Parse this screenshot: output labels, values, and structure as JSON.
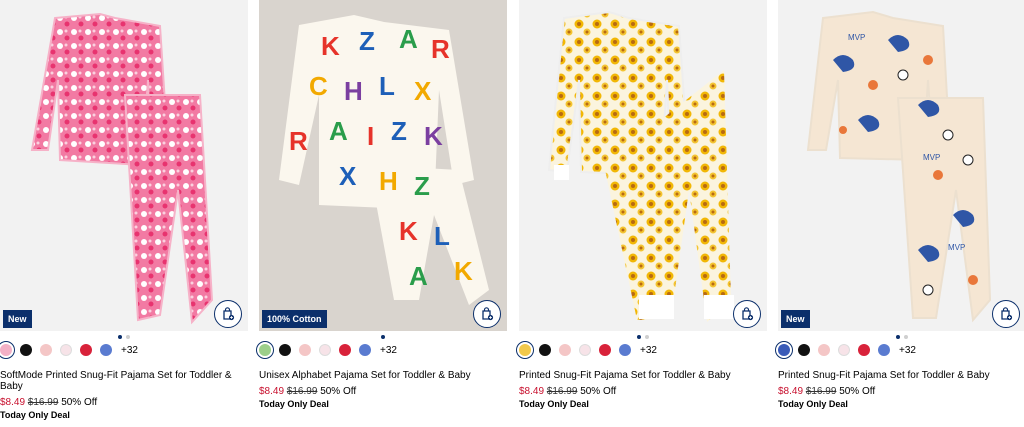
{
  "products": [
    {
      "badge": "New",
      "name": "SoftMode Printed Snug-Fit Pajama Set for Toddler & Baby",
      "sale_price": "$8.49",
      "original_price": "$16.99",
      "discount": "50% Off",
      "deal": "Today Only Deal",
      "more_colors": "+32",
      "colors": [
        "#f3b0c6",
        "#111111",
        "#f4c6c6",
        "#f7e3e8",
        "#d8223a",
        "#5a7bd0"
      ]
    },
    {
      "badge": "100% Cotton",
      "name": "Unisex Alphabet Pajama Set for Toddler & Baby",
      "sale_price": "$8.49",
      "original_price": "$16.99",
      "discount": "50% Off",
      "deal": "Today Only Deal",
      "more_colors": "+32",
      "colors": [
        "#9ccf8a",
        "#111111",
        "#f4c6c6",
        "#f7e3e8",
        "#d8223a",
        "#5a7bd0"
      ]
    },
    {
      "badge": "",
      "name": "Printed Snug-Fit Pajama Set for Toddler & Baby",
      "sale_price": "$8.49",
      "original_price": "$16.99",
      "discount": "50% Off",
      "deal": "Today Only Deal",
      "more_colors": "+32",
      "colors": [
        "#f2c94c",
        "#111111",
        "#f4c6c6",
        "#f7e3e8",
        "#d8223a",
        "#5a7bd0"
      ]
    },
    {
      "badge": "New",
      "name": "Printed Snug-Fit Pajama Set for Toddler & Baby",
      "sale_price": "$8.49",
      "original_price": "$16.99",
      "discount": "50% Off",
      "deal": "Today Only Deal",
      "more_colors": "+32",
      "colors": [
        "#3a5bb8",
        "#111111",
        "#f4c6c6",
        "#f7e3e8",
        "#d8223a",
        "#5a7bd0"
      ]
    }
  ],
  "icons": {
    "bag": "shopping-bag-add-icon"
  },
  "theme": {
    "navy": "#0b2f6b",
    "sale": "#c8102e"
  }
}
